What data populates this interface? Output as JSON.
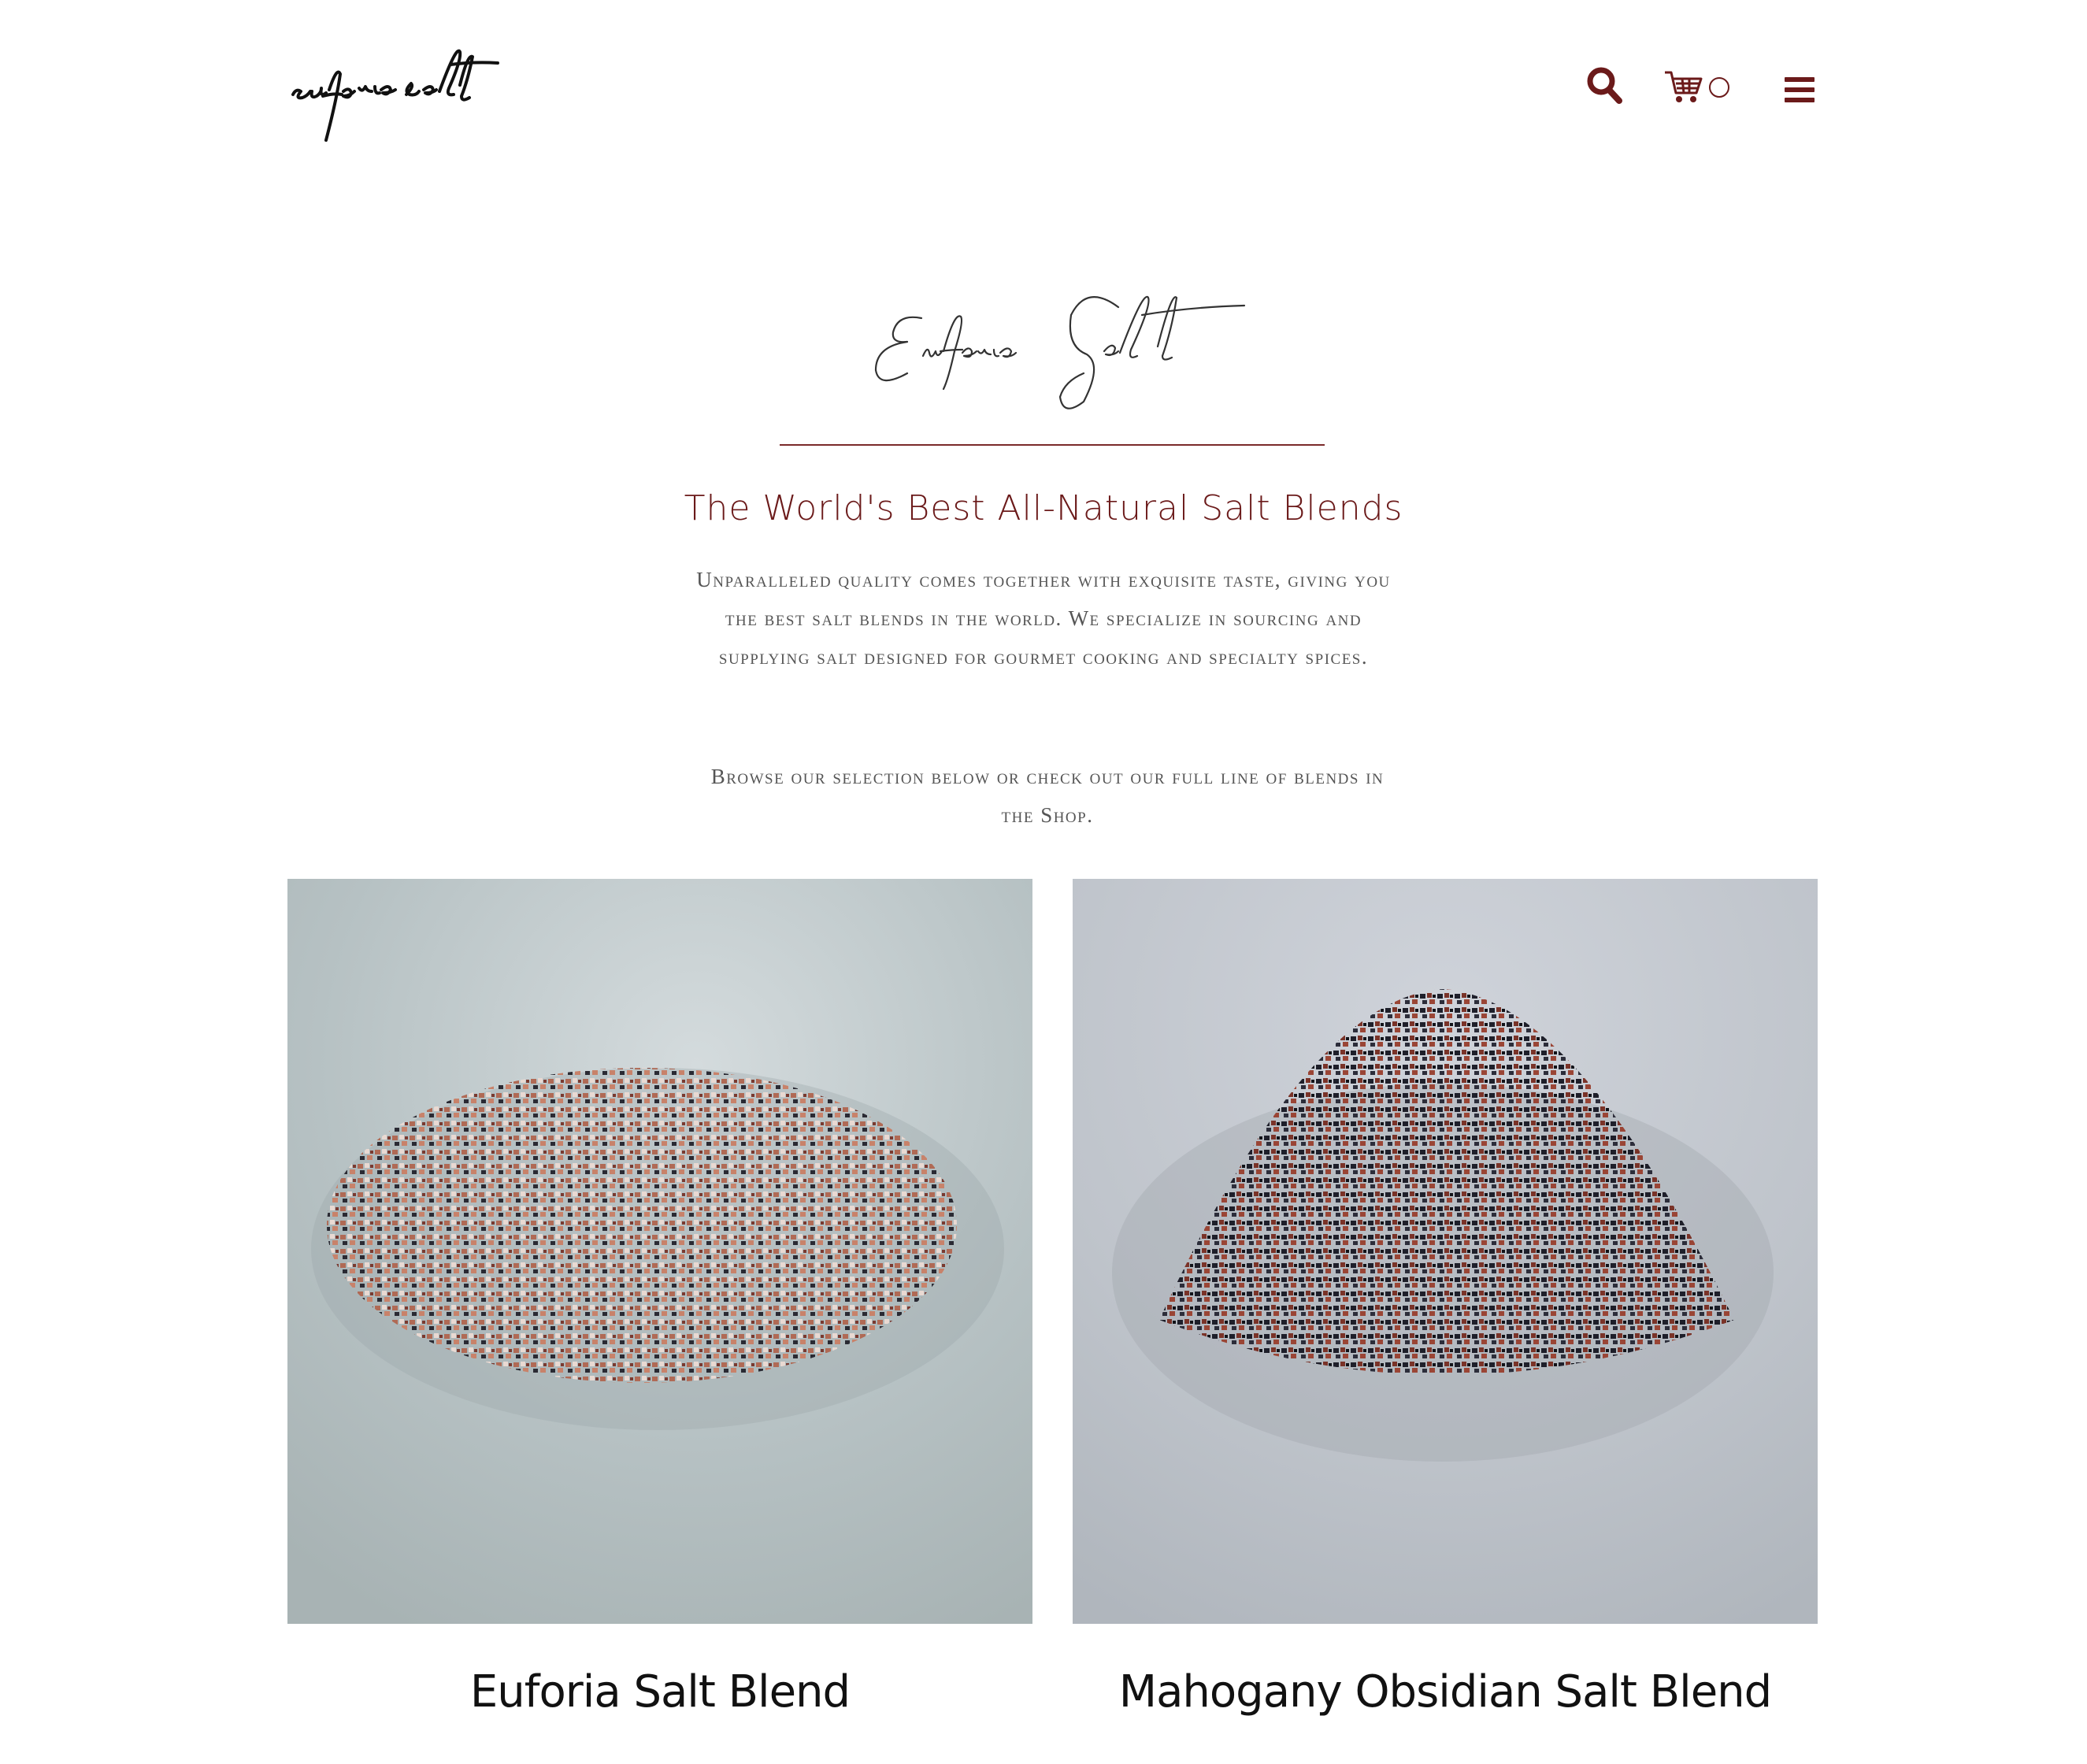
{
  "header": {
    "logo_text": "euforia salt",
    "search_icon": "search-icon",
    "cart_icon": "cart-icon",
    "cart_count": "0",
    "menu_icon": "hamburger-menu-icon",
    "accent_color": "#6b1a1a"
  },
  "hero": {
    "script_title": "Euforia Salt",
    "tagline": "The World's Best All-Natural Salt Blends",
    "description": "Unparalleled quality comes together with exquisite taste, giving you the best salt blends in the world. We specialize in sourcing and supplying salt designed for gourmet cooking and specialty spices.",
    "browse": "Browse our selection below or check out our full line of blends in the Shop."
  },
  "products": [
    {
      "title": "Euforia Salt Blend"
    },
    {
      "title": "Mahogany Obsidian Salt Blend"
    }
  ]
}
